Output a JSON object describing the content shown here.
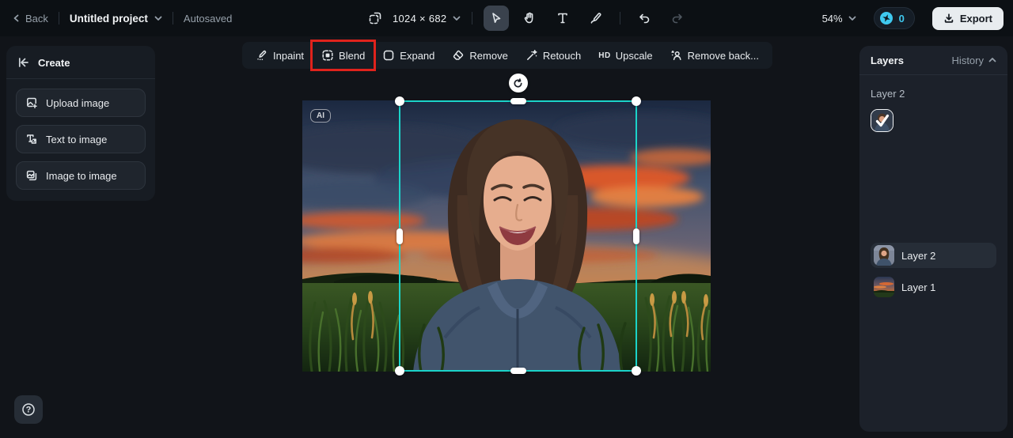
{
  "colors": {
    "background": "#111419",
    "topbar": "#0c1014",
    "panel": "#1c212a",
    "selection_teal": "#1bd3c9",
    "annotation_red": "#e0231c",
    "credits_cyan": "#3fc9ef",
    "export_bg": "#e8ecef"
  },
  "topbar": {
    "back_label": "Back",
    "project_title": "Untitled project",
    "autosaved_label": "Autosaved",
    "canvas_size": "1024 × 682",
    "zoom_level": "54%",
    "credits_count": "0",
    "export_label": "Export"
  },
  "action_toolbar": {
    "items": [
      {
        "label": "Inpaint"
      },
      {
        "label": "Blend",
        "highlighted": true
      },
      {
        "label": "Expand"
      },
      {
        "label": "Remove"
      },
      {
        "label": "Retouch"
      },
      {
        "label": "Upscale",
        "icon_text": "HD"
      },
      {
        "label": "Remove back..."
      }
    ]
  },
  "create_panel": {
    "title": "Create",
    "buttons": [
      {
        "label": "Upload image"
      },
      {
        "label": "Text to image"
      },
      {
        "label": "Image to image"
      }
    ]
  },
  "canvas": {
    "ai_badge": "AI"
  },
  "layers_panel": {
    "title": "Layers",
    "history_label": "History",
    "section_label": "Layer 2",
    "layers": [
      {
        "name": "Layer 2",
        "selected": true,
        "thumb": "portrait"
      },
      {
        "name": "Layer 1",
        "selected": false,
        "thumb": "sunset"
      }
    ]
  },
  "help": {
    "icon_glyph": "?"
  }
}
